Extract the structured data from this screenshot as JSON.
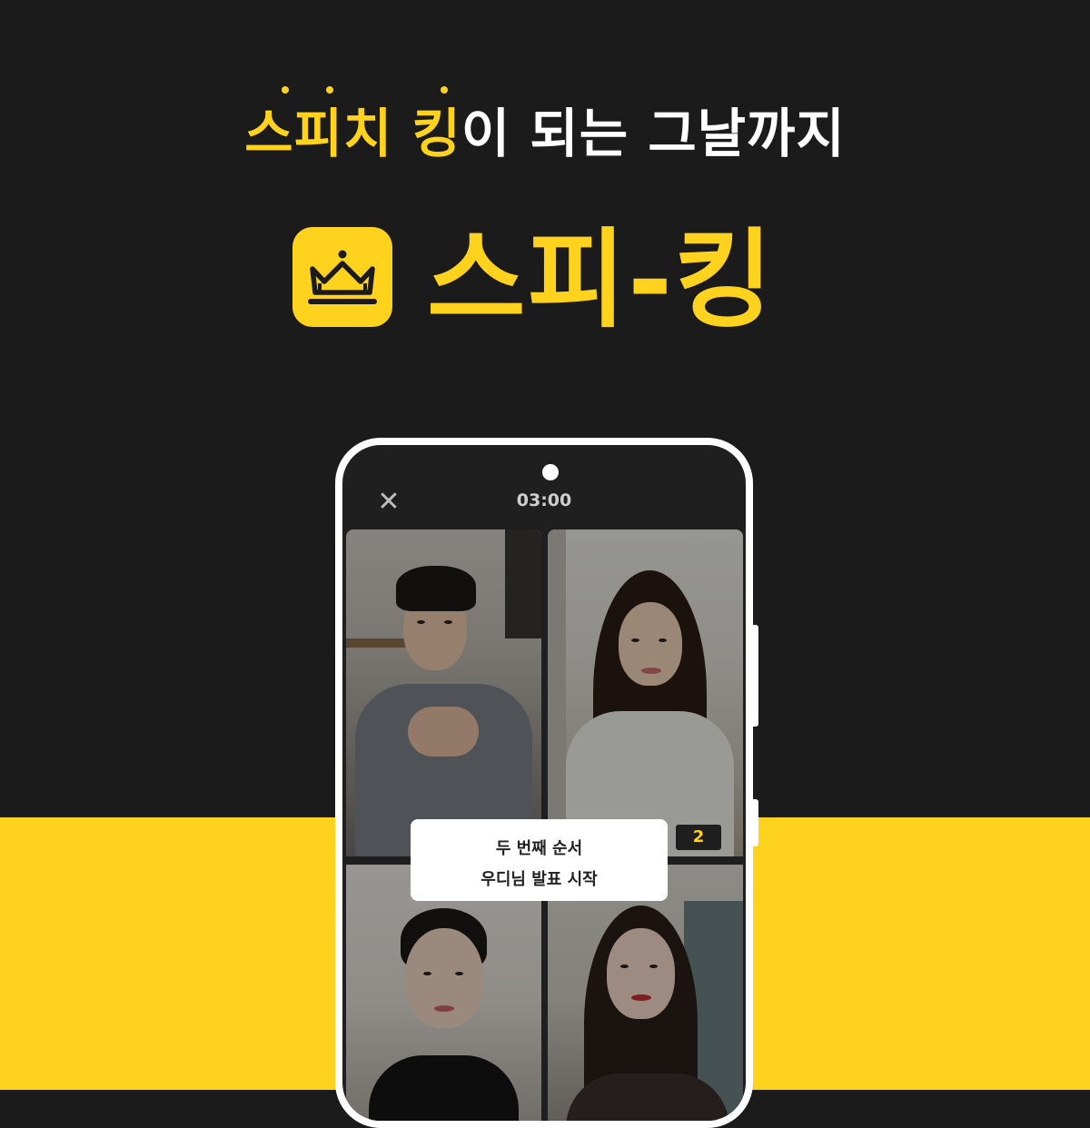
{
  "tagline": {
    "highlight": "스피치 킹",
    "rest": "이 되는 그날까지"
  },
  "logo": {
    "icon": "crown-icon",
    "name": "스피-킹"
  },
  "phone": {
    "close_icon": "close-icon",
    "timer": "03:00",
    "order_badge": "2",
    "toast": {
      "line1": "두 번째 순서",
      "line2": "우디님 발표 시작"
    }
  },
  "colors": {
    "brand_yellow": "#ffd21e",
    "background_dark": "#1c1b1c"
  }
}
